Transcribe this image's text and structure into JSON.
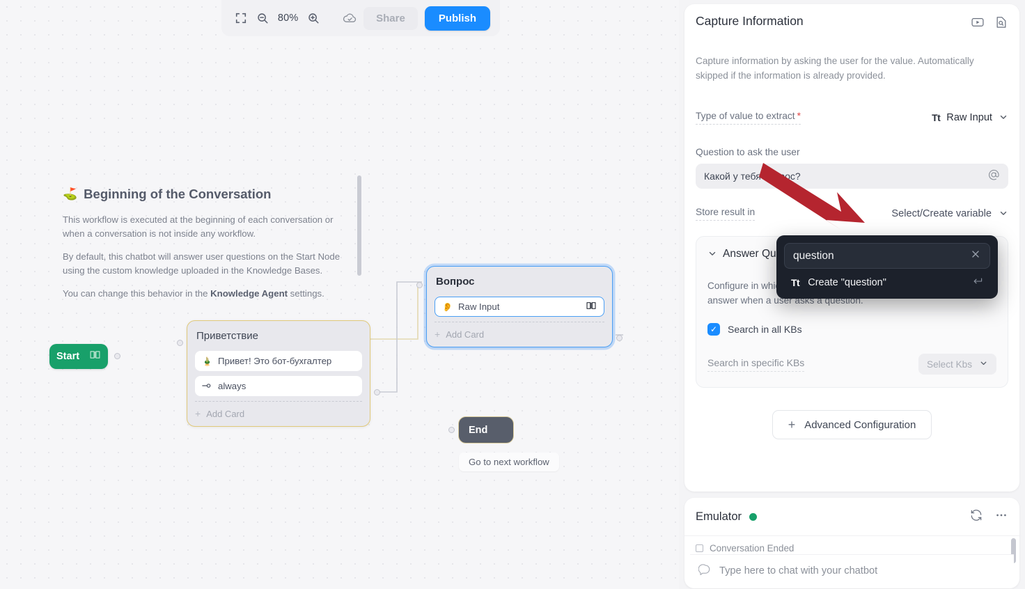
{
  "toolbar": {
    "fit_icon": "fit-screen-icon",
    "zoom_out_icon": "zoom-out-icon",
    "zoom_level": "80%",
    "zoom_in_icon": "zoom-in-icon",
    "save_status_icon": "cloud-check-icon",
    "share_label": "Share",
    "publish_label": "Publish",
    "publish_color": "#1a8cff"
  },
  "canvas": {
    "info": {
      "flag_icon": "golf-flag-icon",
      "title": "Beginning of the Conversation",
      "paragraphs": [
        "This workflow is executed at the beginning of each conversation or when a conversation is not inside any workflow.",
        "By default, this chatbot will answer user questions on the Start Node using the custom knowledge uploaded in the Knowledge Bases."
      ],
      "last_line_pre": "You can change this behavior in the ",
      "last_line_bold": "Knowledge Agent",
      "last_line_post": " settings."
    },
    "start_node": {
      "label": "Start",
      "book_icon": "book-icon",
      "color": "#18a06a"
    },
    "greeting_node": {
      "title": "Приветствие",
      "cards": [
        {
          "icon": "text-message-icon",
          "label": "Привет! Это бот-бухгалтер"
        },
        {
          "icon": "always-trigger-icon",
          "label": "always"
        }
      ],
      "add_card_label": "Add Card",
      "border_color": "#e0c97a"
    },
    "question_node": {
      "title": "Вопрос",
      "cards": [
        {
          "icon": "capture-ear-icon",
          "label": "Raw Input",
          "trailing_icon": "book-icon"
        }
      ],
      "add_card_label": "Add Card",
      "border_color": "#4a9ff5"
    },
    "end_node": {
      "label": "End",
      "color": "#585e6b"
    },
    "next_workflow_label": "Go to next workflow"
  },
  "capture_panel": {
    "title": "Capture Information",
    "video_icon": "video-tutorial-icon",
    "docs_icon": "docs-search-icon",
    "description": "Capture information by asking the user for the value. Automatically skipped if the information is already provided.",
    "type_field": {
      "label": "Type of value to extract",
      "required_marker": "*",
      "value_icon": "text-type-icon",
      "value_icon_label": "Tt",
      "value": "Raw Input",
      "chevron_icon": "chevron-down-icon"
    },
    "question_field": {
      "label": "Question to ask the user",
      "value": "Какой у тебя вопрос?",
      "mention_icon": "at-mention-icon"
    },
    "store_field": {
      "label": "Store result in",
      "value": "Select/Create variable",
      "chevron_icon": "chevron-down-icon"
    },
    "answer_question": {
      "chevron_icon": "chevron-down-icon",
      "title": "Answer Question",
      "toggle_on": true,
      "toggle_color": "#1a8cff",
      "description": "Configure in which Knowledge Bases your chatbot will try to find an answer when a user asks a question.",
      "search_all_label": "Search in all KBs",
      "search_all_checked": true,
      "specific_label": "Search in specific KBs",
      "specific_value": "Select Kbs",
      "specific_chevron_icon": "chevron-down-icon"
    },
    "advanced_label": "Advanced Configuration",
    "advanced_plus_icon": "plus-icon"
  },
  "variable_dropdown": {
    "search_value": "question",
    "clear_icon": "close-icon",
    "option_icon_label": "Tt",
    "option_icon": "text-type-icon",
    "option_label": "Create \"question\"",
    "enter_icon": "enter-key-icon"
  },
  "emulator": {
    "title": "Emulator",
    "status_color": "#17a06a",
    "refresh_icon": "refresh-icon",
    "more_icon": "more-options-icon",
    "conversation_ended_label": "Conversation Ended",
    "chat_icon": "chat-bubble-icon",
    "chat_placeholder": "Type here to chat with your chatbot"
  },
  "annotation": {
    "arrow_color": "#b5252f",
    "arrow_icon": "pointer-arrow"
  }
}
